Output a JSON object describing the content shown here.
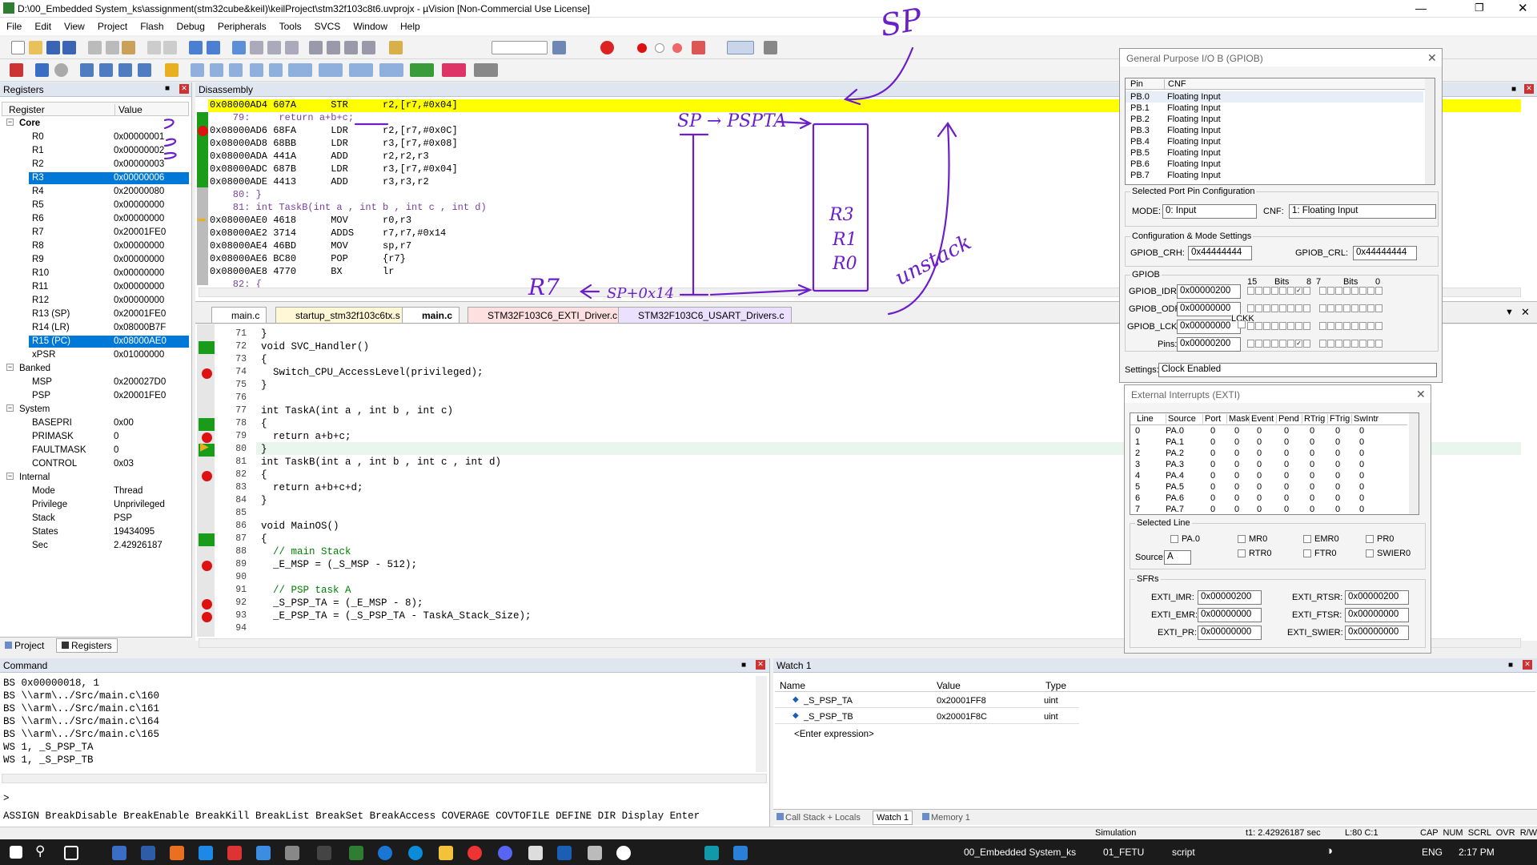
{
  "title": "D:\\00_Embedded System_ks\\assignment(stm32cube&keil)\\keilProject\\stm32f103c8t6.uvprojx - µVision  [Non-Commercial Use License]",
  "menu": [
    "File",
    "Edit",
    "View",
    "Project",
    "Flash",
    "Debug",
    "Peripherals",
    "Tools",
    "SVCS",
    "Window",
    "Help"
  ],
  "registers": {
    "title": "Registers",
    "col_register": "Register",
    "col_value": "Value",
    "groups": {
      "core": "Core",
      "banked": "Banked",
      "system": "System",
      "internal": "Internal"
    },
    "core": [
      {
        "n": "R0",
        "v": "0x00000001"
      },
      {
        "n": "R1",
        "v": "0x00000002"
      },
      {
        "n": "R2",
        "v": "0x00000003"
      },
      {
        "n": "R3",
        "v": "0x00000006"
      },
      {
        "n": "R4",
        "v": "0x20000080"
      },
      {
        "n": "R5",
        "v": "0x00000000"
      },
      {
        "n": "R6",
        "v": "0x00000000"
      },
      {
        "n": "R7",
        "v": "0x20001FE0"
      },
      {
        "n": "R8",
        "v": "0x00000000"
      },
      {
        "n": "R9",
        "v": "0x00000000"
      },
      {
        "n": "R10",
        "v": "0x00000000"
      },
      {
        "n": "R11",
        "v": "0x00000000"
      },
      {
        "n": "R12",
        "v": "0x00000000"
      },
      {
        "n": "R13 (SP)",
        "v": "0x20001FE0"
      },
      {
        "n": "R14 (LR)",
        "v": "0x08000B7F"
      },
      {
        "n": "R15 (PC)",
        "v": "0x08000AE0"
      },
      {
        "n": "xPSR",
        "v": "0x01000000"
      }
    ],
    "banked": [
      {
        "n": "MSP",
        "v": "0x200027D0"
      },
      {
        "n": "PSP",
        "v": "0x20001FE0"
      }
    ],
    "system": [
      {
        "n": "BASEPRI",
        "v": "0x00"
      },
      {
        "n": "PRIMASK",
        "v": "0"
      },
      {
        "n": "FAULTMASK",
        "v": "0"
      },
      {
        "n": "CONTROL",
        "v": "0x03"
      }
    ],
    "internal": [
      {
        "n": "Mode",
        "v": "Thread"
      },
      {
        "n": "Privilege",
        "v": "Unprivileged"
      },
      {
        "n": "Stack",
        "v": "PSP"
      },
      {
        "n": "States",
        "v": "19434095"
      },
      {
        "n": "Sec",
        "v": "2.42926187"
      }
    ],
    "tab_project": "Project",
    "tab_registers": "Registers"
  },
  "disassembly": {
    "title": "Disassembly",
    "lines": [
      "0x08000AD4 607A      STR      r2,[r7,#0x04]",
      "    79:     return a+b+c;",
      "0x08000AD6 68FA      LDR      r2,[r7,#0x0C]",
      "0x08000AD8 68BB      LDR      r3,[r7,#0x08]",
      "0x08000ADA 441A      ADD      r2,r2,r3",
      "0x08000ADC 687B      LDR      r3,[r7,#0x04]",
      "0x08000ADE 4413      ADD      r3,r3,r2",
      "    80: }",
      "    81: int TaskB(int a , int b , int c , int d)",
      "0x08000AE0 4618      MOV      r0,r3",
      "0x08000AE2 3714      ADDS     r7,r7,#0x14",
      "0x08000AE4 46BD      MOV      sp,r7",
      "0x08000AE6 BC80      POP      {r7}",
      "0x08000AE8 4770      BX       lr",
      "    82: {"
    ]
  },
  "tabs": [
    "main.c",
    "startup_stm32f103c6tx.s",
    "main.c",
    "STM32F103C6_EXTI_Driver.c",
    "STM32F103C6_USART_Drivers.c"
  ],
  "source": [
    {
      "n": "71",
      "t": "}"
    },
    {
      "n": "72",
      "t": "void SVC_Handler()"
    },
    {
      "n": "73",
      "t": "{"
    },
    {
      "n": "74",
      "t": "  Switch_CPU_AccessLevel(privileged);"
    },
    {
      "n": "75",
      "t": "}"
    },
    {
      "n": "76",
      "t": ""
    },
    {
      "n": "77",
      "t": "int TaskA(int a , int b , int c)"
    },
    {
      "n": "78",
      "t": "{"
    },
    {
      "n": "79",
      "t": "  return a+b+c;"
    },
    {
      "n": "80",
      "t": "}"
    },
    {
      "n": "81",
      "t": "int TaskB(int a , int b , int c , int d)"
    },
    {
      "n": "82",
      "t": "{"
    },
    {
      "n": "83",
      "t": "  return a+b+c+d;"
    },
    {
      "n": "84",
      "t": "}"
    },
    {
      "n": "85",
      "t": ""
    },
    {
      "n": "86",
      "t": "void MainOS()"
    },
    {
      "n": "87",
      "t": "{"
    },
    {
      "n": "88",
      "t": "  // main Stack"
    },
    {
      "n": "89",
      "t": "  _E_MSP = (_S_MSP - 512);"
    },
    {
      "n": "90",
      "t": ""
    },
    {
      "n": "91",
      "t": "  // PSP task A"
    },
    {
      "n": "92",
      "t": "  _S_PSP_TA = (_E_MSP - 8);"
    },
    {
      "n": "93",
      "t": "  _E_PSP_TA = (_S_PSP_TA - TaskA_Stack_Size);"
    },
    {
      "n": "94",
      "t": ""
    }
  ],
  "gpio": {
    "title": "General Purpose I/O B (GPIOB)",
    "col_pin": "Pin",
    "col_cnf": "CNF",
    "pins": [
      {
        "p": "PB.0",
        "c": "Floating Input"
      },
      {
        "p": "PB.1",
        "c": "Floating Input"
      },
      {
        "p": "PB.2",
        "c": "Floating Input"
      },
      {
        "p": "PB.3",
        "c": "Floating Input"
      },
      {
        "p": "PB.4",
        "c": "Floating Input"
      },
      {
        "p": "PB.5",
        "c": "Floating Input"
      },
      {
        "p": "PB.6",
        "c": "Floating Input"
      },
      {
        "p": "PB.7",
        "c": "Floating Input"
      }
    ],
    "selected_group": "Selected Port Pin Configuration",
    "mode_label": "MODE:",
    "mode_value": "0: Input",
    "cnf_label": "CNF:",
    "cnf_value": "1: Floating Input",
    "cfg_group": "Configuration & Mode Settings",
    "crh_label": "GPIOB_CRH:",
    "crh_value": "0x44444444",
    "crl_label": "GPIOB_CRL:",
    "crl_value": "0x44444444",
    "gpio_group": "GPIOB",
    "idr_label": "GPIOB_IDR:",
    "idr_value": "0x00000200",
    "odr_label": "GPIOB_ODR:",
    "odr_value": "0x00000000",
    "lckr_label": "GPIOB_LCKR:",
    "lckr_value": "0x00000000",
    "pins_label": "Pins:",
    "pins_value": "0x00000200",
    "lckk": "LCKK",
    "bits_15": "15",
    "bits_label": "Bits",
    "bits_8": "8",
    "bits_7": "7",
    "bits_label2": "Bits",
    "bits_0": "0",
    "settings_label": "Settings:",
    "settings_value": "Clock Enabled"
  },
  "exti": {
    "title": "External Interrupts (EXTI)",
    "cols": [
      "Line",
      "Source",
      "Port",
      "Mask",
      "Event",
      "Pend",
      "RTrig",
      "FTrig",
      "SwIntr"
    ],
    "rows": [
      [
        "0",
        "PA.0",
        "0",
        "0",
        "0",
        "0",
        "0",
        "0",
        "0"
      ],
      [
        "1",
        "PA.1",
        "0",
        "0",
        "0",
        "0",
        "0",
        "0",
        "0"
      ],
      [
        "2",
        "PA.2",
        "0",
        "0",
        "0",
        "0",
        "0",
        "0",
        "0"
      ],
      [
        "3",
        "PA.3",
        "0",
        "0",
        "0",
        "0",
        "0",
        "0",
        "0"
      ],
      [
        "4",
        "PA.4",
        "0",
        "0",
        "0",
        "0",
        "0",
        "0",
        "0"
      ],
      [
        "5",
        "PA.5",
        "0",
        "0",
        "0",
        "0",
        "0",
        "0",
        "0"
      ],
      [
        "6",
        "PA.6",
        "0",
        "0",
        "0",
        "0",
        "0",
        "0",
        "0"
      ],
      [
        "7",
        "PA.7",
        "0",
        "0",
        "0",
        "0",
        "0",
        "0",
        "0"
      ]
    ],
    "selected_line": "Selected Line",
    "chk": [
      "PA.0",
      "MR0",
      "EMR0",
      "PR0",
      "RTR0",
      "FTR0",
      "SWIER0"
    ],
    "source_label": "Source:",
    "source_value": "A",
    "sfrs": "SFRs",
    "imr_l": "EXTI_IMR:",
    "imr_v": "0x00000200",
    "rtsr_l": "EXTI_RTSR:",
    "rtsr_v": "0x00000200",
    "emr_l": "EXTI_EMR:",
    "emr_v": "0x00000000",
    "ftsr_l": "EXTI_FTSR:",
    "ftsr_v": "0x00000000",
    "pr_l": "EXTI_PR:",
    "pr_v": "0x00000000",
    "swier_l": "EXTI_SWIER:",
    "swier_v": "0x00000000"
  },
  "command": {
    "title": "Command",
    "lines": [
      "BS 0x00000018, 1",
      "BS \\\\arm\\../Src/main.c\\160",
      "BS \\\\arm\\../Src/main.c\\161",
      "BS \\\\arm\\../Src/main.c\\164",
      "BS \\\\arm\\../Src/main.c\\165",
      "WS 1, _S_PSP_TA",
      "WS 1, _S_PSP_TB"
    ],
    "prompt": ">",
    "hint": "ASSIGN BreakDisable BreakEnable BreakKill BreakList BreakSet BreakAccess COVERAGE COVTOFILE DEFINE DIR Display Enter"
  },
  "watch": {
    "title": "Watch 1",
    "col_name": "Name",
    "col_value": "Value",
    "col_type": "Type",
    "rows": [
      {
        "n": "_S_PSP_TA",
        "v": "0x20001FF8",
        "t": "uint"
      },
      {
        "n": "_S_PSP_TB",
        "v": "0x20001F8C",
        "t": "uint"
      }
    ],
    "enter": "<Enter expression>",
    "tabs": [
      "Call Stack + Locals",
      "Watch 1",
      "Memory 1"
    ]
  },
  "status": {
    "mode": "Simulation",
    "time": "t1: 2.42926187 sec",
    "pos": "L:80 C:1",
    "flags": "CAP  NUM  SCRL  OVR  R/W"
  },
  "taskbar": {
    "win1": "00_Embedded System_ks",
    "win2": "01_FETU",
    "win3": "script",
    "lang": "ENG",
    "time": "2:17 PM"
  },
  "annotations": {
    "sp_top": "SP",
    "sp_psp": "SP → PSPTA",
    "r3": "R3",
    "r1": "R1",
    "r0": "R0",
    "unstack": "unstack",
    "r7": "R7",
    "sp_plus": "SP+0x14"
  },
  "colors": {
    "accent": "#0078d7",
    "highlight": "#ffff00",
    "ink": "#6a1fc9",
    "breakpoint": "#dd1111",
    "green": "#1a9b1a"
  }
}
